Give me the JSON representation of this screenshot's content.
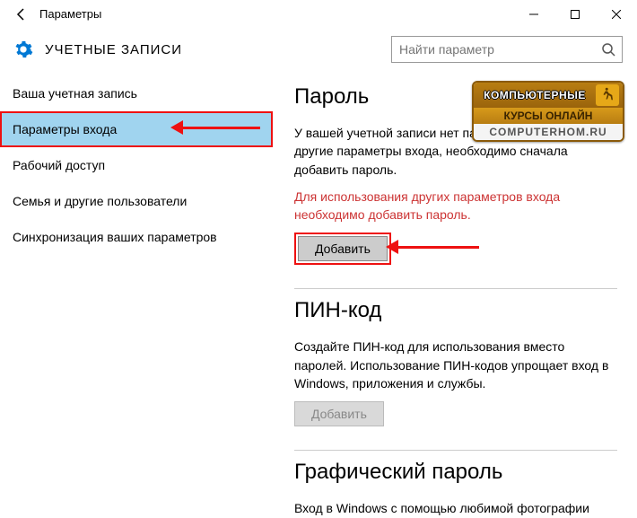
{
  "titlebar": {
    "title": "Параметры"
  },
  "header": {
    "page_title": "УЧЕТНЫЕ ЗАПИСИ",
    "search_placeholder": "Найти параметр"
  },
  "sidebar": {
    "items": [
      {
        "label": "Ваша учетная запись"
      },
      {
        "label": "Параметры входа"
      },
      {
        "label": "Рабочий доступ"
      },
      {
        "label": "Семья и другие пользователи"
      },
      {
        "label": "Синхронизация ваших параметров"
      }
    ]
  },
  "content": {
    "password": {
      "heading": "Пароль",
      "desc": "У вашей учетной записи нет пароля. Чтобы настроить другие параметры входа, необходимо сначала добавить пароль.",
      "warn": "Для использования других параметров входа необходимо добавить пароль.",
      "button": "Добавить"
    },
    "pin": {
      "heading": "ПИН-код",
      "desc": "Создайте ПИН-код для использования вместо паролей. Использование ПИН-кодов упрощает вход в Windows, приложения и службы.",
      "button": "Добавить"
    },
    "picture": {
      "heading": "Графический пароль",
      "desc": "Вход в Windows с помощью любимой фотографии"
    }
  },
  "watermark": {
    "line1": "КОМПЬЮТЕРНЫЕ",
    "line2": "КУРСЫ  ОНЛАЙН",
    "line3": "COMPUTERHOM.RU"
  }
}
